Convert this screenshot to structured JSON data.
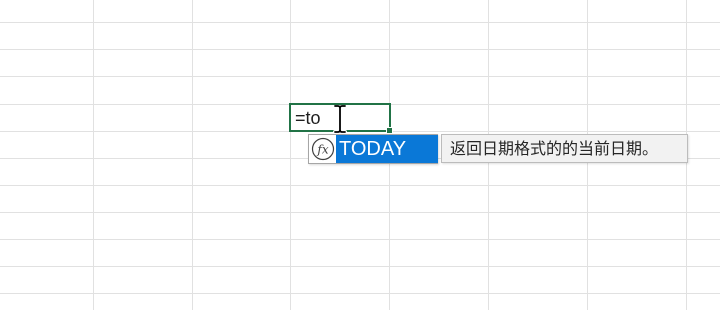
{
  "cell": {
    "input_text": "=to"
  },
  "autocomplete": {
    "icon": "function-fx-icon",
    "items": [
      {
        "label": "TODAY",
        "selected": true
      }
    ]
  },
  "tooltip": {
    "text": "返回日期格式的的当前日期。"
  },
  "colors": {
    "active_cell_border": "#217346",
    "selection": "#0a78d7",
    "gridline": "#e1e1e1",
    "tooltip_bg": "#f2f2f2"
  }
}
